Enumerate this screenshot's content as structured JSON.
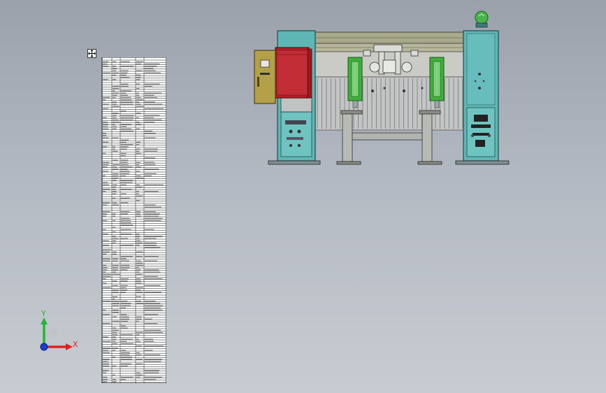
{
  "viewport": {
    "background_top": "#9aa1ab",
    "background_bottom": "#c8ccd2"
  },
  "move_handle": {
    "icon": "move-icon"
  },
  "bom_table": {
    "icon": "bill-of-materials-table",
    "line_color": "#000000",
    "fill_color": "#ffffff"
  },
  "model": {
    "icon": "machine-assembly-model",
    "colors": {
      "frame_teal": "#5fb7b5",
      "frame_dark": "#2e6e70",
      "cabinet_red": "#b0202a",
      "control_box": "#b5a04a",
      "cylinder_green": "#3fae3a",
      "beam_olive": "#9a9a78",
      "ball_green": "#47b54b"
    }
  },
  "triad": {
    "x_label": "X",
    "y_label": "Y",
    "x_color": "#e0231f",
    "y_color": "#27b33a",
    "z_color": "#1a3fd0"
  }
}
